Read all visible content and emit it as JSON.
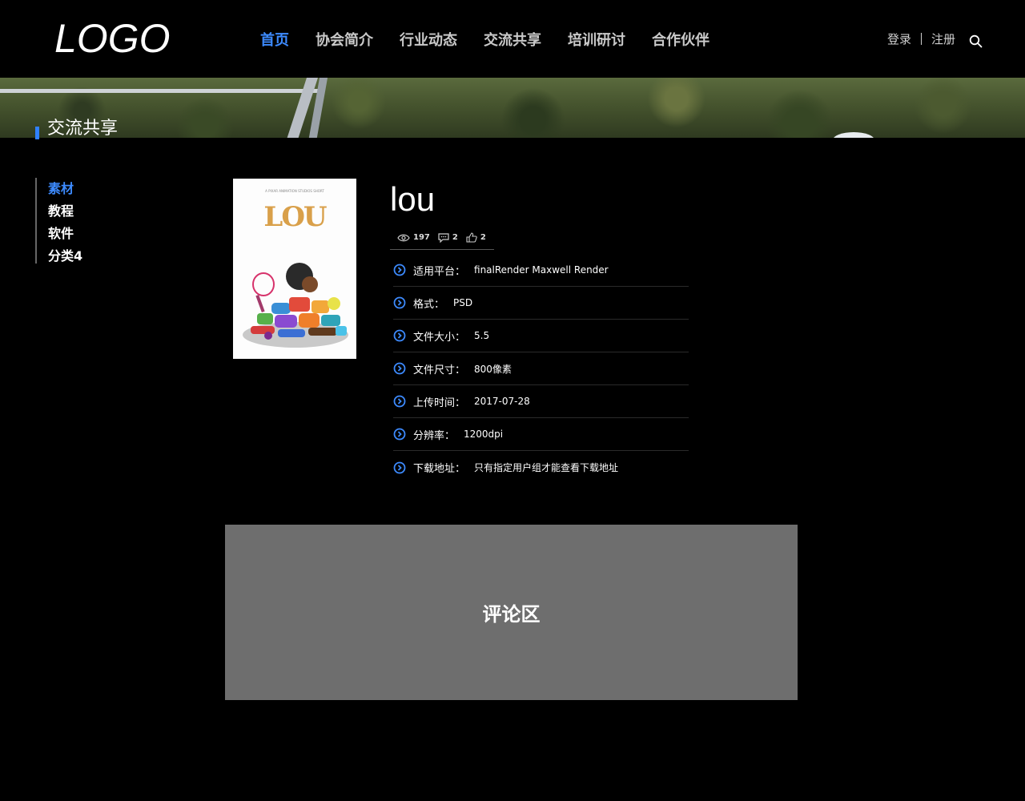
{
  "header": {
    "logo": "LOGO",
    "nav": [
      {
        "label": "首页",
        "active": true
      },
      {
        "label": "协会简介",
        "active": false
      },
      {
        "label": "行业动态",
        "active": false
      },
      {
        "label": "交流共享",
        "active": false
      },
      {
        "label": "培训研讨",
        "active": false
      },
      {
        "label": "合作伙伴",
        "active": false
      }
    ],
    "login": "登录",
    "register": "注册"
  },
  "banner": {
    "title": "交流共享"
  },
  "sidebar": {
    "items": [
      {
        "label": "素材",
        "active": true
      },
      {
        "label": "教程",
        "active": false
      },
      {
        "label": "软件",
        "active": false
      },
      {
        "label": "分类4",
        "active": false
      }
    ]
  },
  "poster": {
    "tagline": "A PIXAR ANIMATION STUDIOS SHORT",
    "title": "LOU"
  },
  "detail": {
    "title": "lou",
    "views": "197",
    "comments": "2",
    "likes": "2",
    "info": [
      {
        "key": "适用平台：",
        "value": "finalRender Maxwell Render"
      },
      {
        "key": "格式：",
        "value": "PSD"
      },
      {
        "key": "文件大小：",
        "value": "5.5"
      },
      {
        "key": "文件尺寸：",
        "value": "800像素"
      },
      {
        "key": "上传时间：",
        "value": "2017-07-28"
      },
      {
        "key": "分辨率：",
        "value": "1200dpi"
      },
      {
        "key": "下载地址：",
        "value": "只有指定用户组才能查看下载地址"
      }
    ]
  },
  "comments": {
    "label": "评论区"
  },
  "colors": {
    "accent": "#3d8bff",
    "background": "#000000",
    "comment_bg": "#6e6e6e"
  }
}
